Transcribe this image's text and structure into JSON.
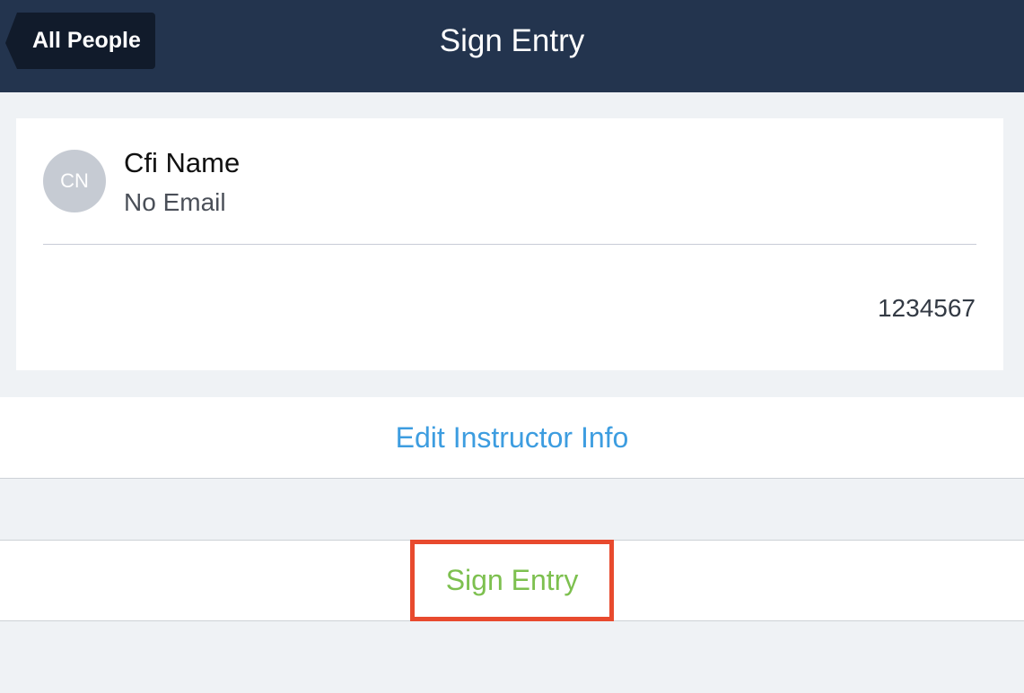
{
  "navbar": {
    "back_label": "All People",
    "title": "Sign Entry"
  },
  "instructor": {
    "initials": "CN",
    "name": "Cfi Name",
    "email": "No Email",
    "certificate_number": "1234567"
  },
  "actions": {
    "edit_label": "Edit Instructor Info",
    "sign_label": "Sign Entry"
  },
  "colors": {
    "navbar_bg": "#23344e",
    "back_button_bg": "#111b2b",
    "edit_link": "#3d9de0",
    "sign_button_text": "#7dc04f",
    "highlight_border": "#e84a2e"
  }
}
